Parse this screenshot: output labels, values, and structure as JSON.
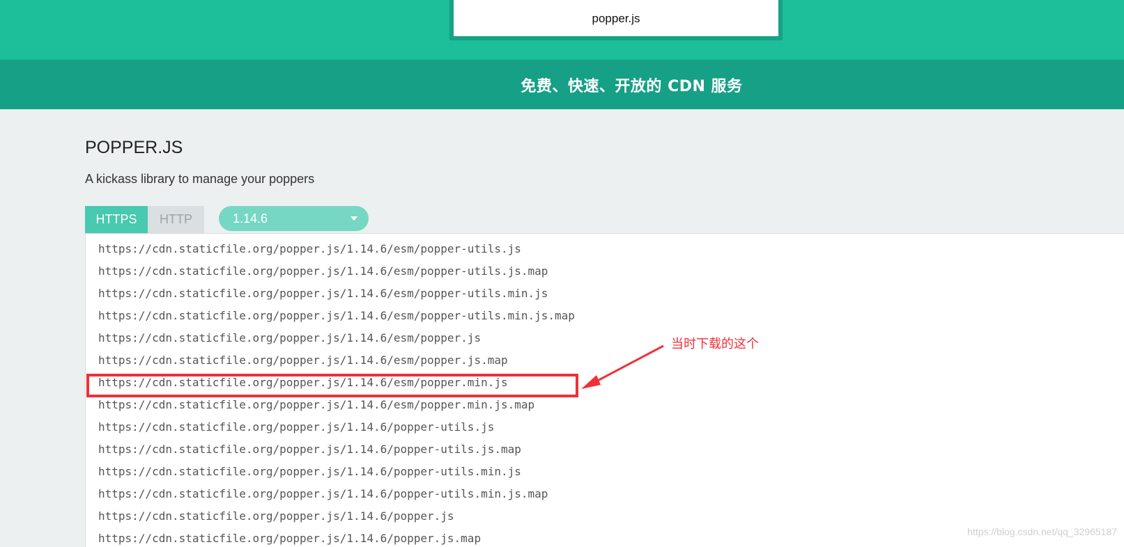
{
  "header": {
    "search_value": "popper.js",
    "subtitle": "免费、快速、开放的 CDN 服务"
  },
  "library": {
    "title": "POPPER.JS",
    "description": "A kickass library to manage your poppers"
  },
  "protocol_tabs": [
    {
      "label": "HTTPS",
      "active": true
    },
    {
      "label": "HTTP",
      "active": false
    }
  ],
  "version_select": {
    "selected": "1.14.6"
  },
  "files": [
    "https://cdn.staticfile.org/popper.js/1.14.6/esm/popper-utils.js",
    "https://cdn.staticfile.org/popper.js/1.14.6/esm/popper-utils.js.map",
    "https://cdn.staticfile.org/popper.js/1.14.6/esm/popper-utils.min.js",
    "https://cdn.staticfile.org/popper.js/1.14.6/esm/popper-utils.min.js.map",
    "https://cdn.staticfile.org/popper.js/1.14.6/esm/popper.js",
    "https://cdn.staticfile.org/popper.js/1.14.6/esm/popper.js.map",
    "https://cdn.staticfile.org/popper.js/1.14.6/esm/popper.min.js",
    "https://cdn.staticfile.org/popper.js/1.14.6/esm/popper.min.js.map",
    "https://cdn.staticfile.org/popper.js/1.14.6/popper-utils.js",
    "https://cdn.staticfile.org/popper.js/1.14.6/popper-utils.js.map",
    "https://cdn.staticfile.org/popper.js/1.14.6/popper-utils.min.js",
    "https://cdn.staticfile.org/popper.js/1.14.6/popper-utils.min.js.map",
    "https://cdn.staticfile.org/popper.js/1.14.6/popper.js",
    "https://cdn.staticfile.org/popper.js/1.14.6/popper.js.map"
  ],
  "annotation": {
    "text": "当时下载的这个",
    "color": "#f03038"
  },
  "watermark": "https://blog.csdn.net/qq_32965187",
  "colors": {
    "banner": "#1dbe9a",
    "subtitle_bar": "#16a085",
    "tab_active": "#48c9b0",
    "version_select": "#76d7c4"
  }
}
